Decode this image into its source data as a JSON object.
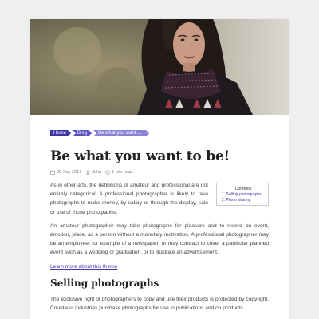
{
  "breadcrumb": {
    "home": "Home",
    "blog": "Blog",
    "current": "Be what you want ..."
  },
  "article": {
    "title": "Be what you want to be!",
    "meta": {
      "date": "06 Sep 2017",
      "author": "John",
      "read_time": "1 min read."
    },
    "intro": "As in other arts, the definitions of amateur and professional are not entirely categorical. A professional photographer is likely to take photographs to make money, by salary or through the display, sale or use of those photographs.",
    "paragraph2": "An amateur photographer may take photographs for pleasure and to record an event, emotion, place, as a person without a monetary motivation. A professional photographer may be an employee, for example of a newspaper, or may contract to cover a particular planned event such as a wedding or graduation, or to illustrate an advertisement.",
    "learn_more": "Learn more about this theme",
    "section_heading": "Selling photographs",
    "paragraph3": "The exclusive right of photographers to copy and use their products is protected by copyright. Countless industries purchase photographs for use in publications and on products."
  },
  "toc": {
    "title": "Contents",
    "items": [
      "1. Selling photographs",
      "2. Photo sharing"
    ]
  },
  "colors": {
    "accent": "#3f34a8",
    "page_bg": "#efefef"
  }
}
